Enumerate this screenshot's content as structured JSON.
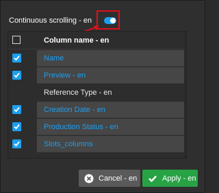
{
  "settings": {
    "continuous_scrolling_label": "Continuous scrolling - en",
    "continuous_scrolling_on": true
  },
  "columns_table": {
    "header_label": "Column name - en",
    "rows": [
      {
        "label": "Name",
        "checked": true,
        "enabled": true
      },
      {
        "label": "Preview - en",
        "checked": true,
        "enabled": true
      },
      {
        "label": "Reference Type - en",
        "checked": false,
        "enabled": false
      },
      {
        "label": "Creation Date - en",
        "checked": true,
        "enabled": true
      },
      {
        "label": "Production Status - en",
        "checked": true,
        "enabled": true
      },
      {
        "label": "Slots_columns",
        "checked": true,
        "enabled": true
      }
    ]
  },
  "footer": {
    "cancel_label": "Cancel - en",
    "apply_label": "Apply - en"
  },
  "colors": {
    "accent": "#1d9ff0",
    "apply_green": "#27a244",
    "highlight_red": "#e0101b"
  },
  "icons": {
    "cancel": "close-circle-icon",
    "apply": "checkmark-icon"
  }
}
